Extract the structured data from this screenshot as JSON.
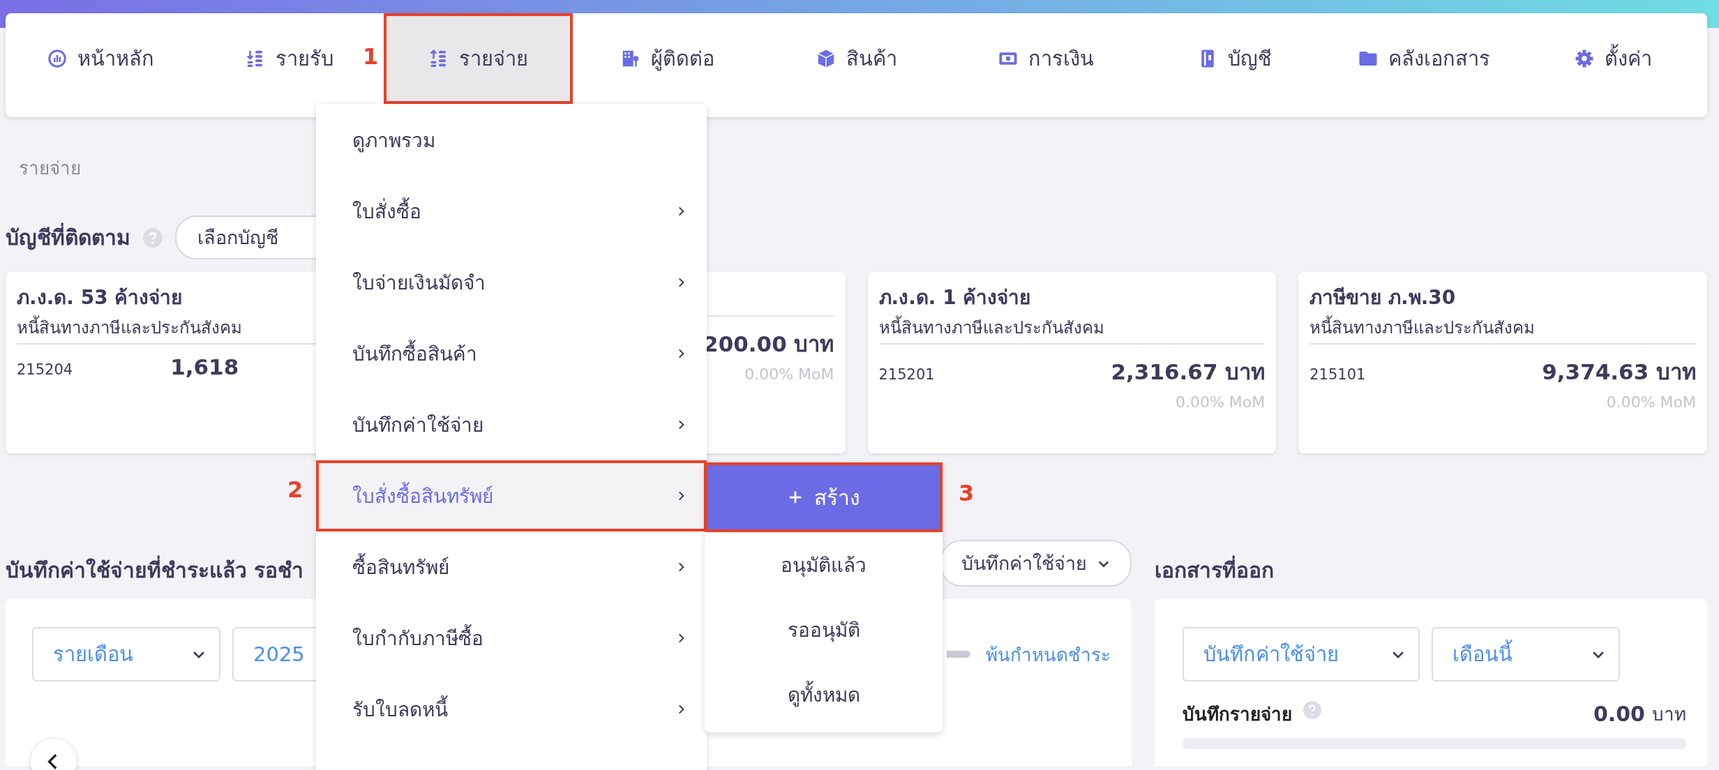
{
  "top_nav": {
    "items": [
      {
        "label": "หน้าหลัก",
        "selected": false
      },
      {
        "label": "รายรับ",
        "selected": false
      },
      {
        "label": "รายจ่าย",
        "selected": true
      },
      {
        "label": "ผู้ติดต่อ",
        "selected": false
      },
      {
        "label": "สินค้า",
        "selected": false
      },
      {
        "label": "การเงิน",
        "selected": false
      },
      {
        "label": "บัญชี",
        "selected": false
      },
      {
        "label": "คลังเอกสาร",
        "selected": false
      },
      {
        "label": "ตั้งค่า",
        "selected": false
      }
    ]
  },
  "breadcrumb": "รายจ่าย",
  "tracked_accounts": {
    "title": "บัญชีที่ติดตาม",
    "select_button": "เลือกบัญชี",
    "cards": [
      {
        "title": "ภ.ง.ด. 53 ค้างจ่าย",
        "subtitle": "หนี้สินทางภาษีและประกันสังคม",
        "code": "215204",
        "amount": "1,618"
      },
      {
        "amount": "200.00 บาท",
        "change": "0.00% MoM"
      },
      {
        "title": "ภ.ง.ด. 1 ค้างจ่าย",
        "subtitle": "หนี้สินทางภาษีและประกันสังคม",
        "code": "215201",
        "amount": "2,316.67 บาท",
        "change": "0.00% MoM"
      },
      {
        "title": "ภาษีขาย ภ.พ.30",
        "subtitle": "หนี้สินทางภาษีและประกันสังคม",
        "code": "215101",
        "amount": "9,374.63 บาท",
        "change": "0.00% MoM"
      }
    ]
  },
  "paid_expenses": {
    "title": "บันทึกค่าใช้จ่ายที่ชำระแล้ว รอชำ",
    "filter": "บันทึกค่าใช้จ่าย",
    "period_select": "รายเดือน",
    "year_select": "2025",
    "overdue_link": "พ้นกำหนดชำระ"
  },
  "issued_documents": {
    "title": "เอกสารที่ออก",
    "type_select": "บันทึกค่าใช้จ่าย",
    "period_select": "เดือนนี้",
    "stat_label": "บันทึกรายจ่าย",
    "stat_value": "0.00",
    "stat_unit": "บาท"
  },
  "menu": {
    "items": [
      {
        "label": "ดูภาพรวม",
        "has_submenu": false,
        "selected": false
      },
      {
        "label": "ใบสั่งซื้อ",
        "has_submenu": true,
        "selected": false
      },
      {
        "label": "ใบจ่ายเงินมัดจำ",
        "has_submenu": true,
        "selected": false
      },
      {
        "label": "บันทึกซื้อสินค้า",
        "has_submenu": true,
        "selected": false
      },
      {
        "label": "บันทึกค่าใช้จ่าย",
        "has_submenu": true,
        "selected": false
      },
      {
        "label": "ใบสั่งซื้อสินทรัพย์",
        "has_submenu": true,
        "selected": true
      },
      {
        "label": "ซื้อสินทรัพย์",
        "has_submenu": true,
        "selected": false
      },
      {
        "label": "ใบกำกับภาษีซื้อ",
        "has_submenu": true,
        "selected": false
      },
      {
        "label": "รับใบลดหนี้",
        "has_submenu": true,
        "selected": false
      }
    ]
  },
  "submenu": {
    "items": [
      {
        "label": "สร้าง",
        "kind": "create"
      },
      {
        "label": "อนุมัติแล้ว",
        "kind": "plain"
      },
      {
        "label": "รออนุมัติ",
        "kind": "plain"
      },
      {
        "label": "ดูทั้งหมด",
        "kind": "plain"
      }
    ]
  },
  "annotations": [
    {
      "label": "1"
    },
    {
      "label": "2"
    },
    {
      "label": "3"
    }
  ]
}
